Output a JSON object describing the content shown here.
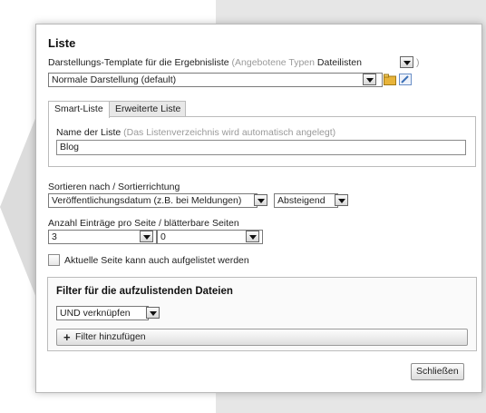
{
  "dialog": {
    "title": "Liste",
    "template_label": "Darstellungs-Template für die Ergebnisliste",
    "template_hint": "(Angebotene Typen",
    "template_type_value": "Dateilisten",
    "template_hint_end": ")",
    "template_select_value": "Normale Darstellung (default)",
    "tabs": [
      "Smart-Liste",
      "Erweiterte Liste"
    ],
    "list_name_label": "Name der Liste",
    "list_name_hint": "(Das Listenverzeichnis wird automatisch angelegt)",
    "list_name_value": "Blog",
    "sort_label": "Sortieren nach / Sortierrichtung",
    "sort_by_value": "Veröffentlichungsdatum (z.B. bei Meldungen)",
    "sort_dir_value": "Absteigend",
    "entries_label": "Anzahl Einträge pro Seite / blätterbare Seiten",
    "entries_value": "3",
    "pages_value": "0",
    "checkbox_label": "Aktuelle Seite kann auch aufgelistet werden",
    "filter_title": "Filter für die aufzulistenden Dateien",
    "filter_combine_value": "UND verknüpfen",
    "add_filter_label": "Filter hinzufügen",
    "close_label": "Schließen"
  },
  "colors": {
    "background_right": "#e6e6e6",
    "folder_icon": "#e8b43a",
    "edit_icon": "#6a8fc7"
  }
}
